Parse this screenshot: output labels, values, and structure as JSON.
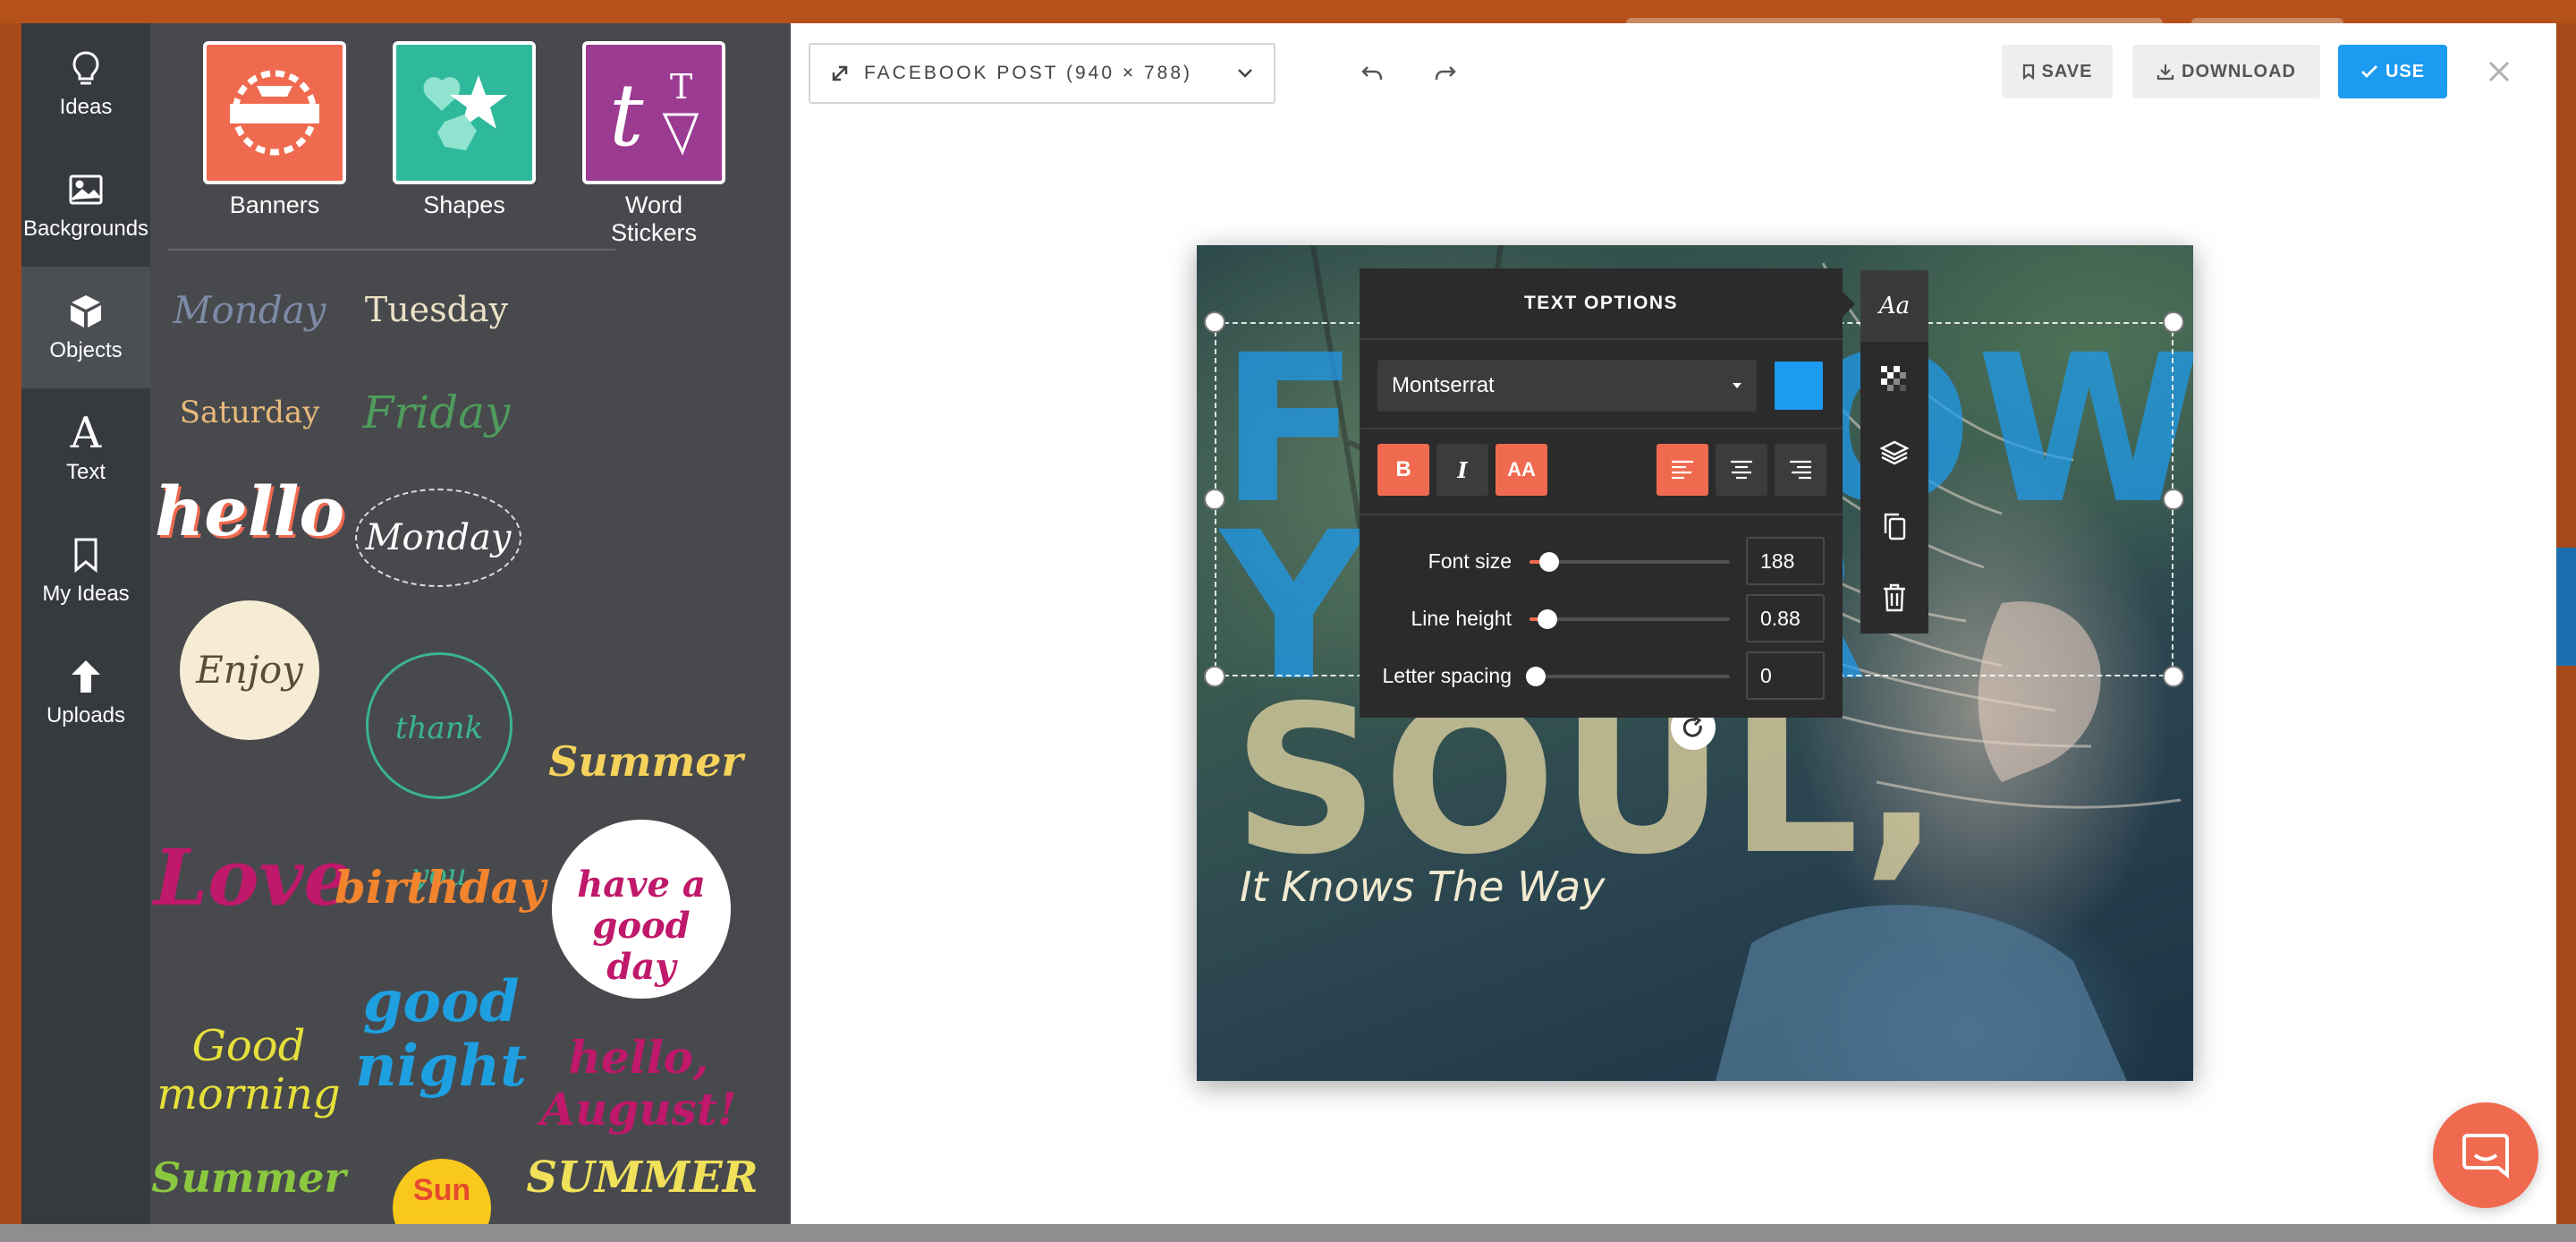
{
  "nav": {
    "items": [
      {
        "label": "Ideas",
        "icon": "lightbulb-icon"
      },
      {
        "label": "Backgrounds",
        "icon": "image-icon"
      },
      {
        "label": "Objects",
        "icon": "cube-icon",
        "active": true
      },
      {
        "label": "Text",
        "icon": "text-icon"
      },
      {
        "label": "My Ideas",
        "icon": "bookmark-icon"
      },
      {
        "label": "Uploads",
        "icon": "upload-arrow-icon"
      }
    ]
  },
  "panel": {
    "categories": [
      {
        "label": "Banners",
        "color": "#f06a4f"
      },
      {
        "label": "Shapes",
        "color": "#2fb99c"
      },
      {
        "label": "Word Stickers",
        "color": "#9b3b92"
      }
    ],
    "stickers": [
      "Monday",
      "Tuesday",
      "Saturday",
      "Friday",
      "hello",
      "Monday",
      "Enjoy",
      "thank you",
      "Summer",
      "Love",
      "birthday",
      "have a good day",
      "good night",
      "Good morning",
      "hello, August!",
      "Summer",
      "Sun",
      "SUMMER"
    ]
  },
  "toolbar": {
    "size_label": "FACEBOOK POST (940 × 788)",
    "save_label": "SAVE",
    "download_label": "DOWNLOAD",
    "use_label": "USE"
  },
  "canvas": {
    "line1": "FOLLOW",
    "line2": "YOUR",
    "line3": "SOUL,",
    "tagline": "It Knows The Way"
  },
  "text_options": {
    "title": "TEXT OPTIONS",
    "font": "Montserrat",
    "color": "#1d9bf0",
    "bold_label": "B",
    "italic_label": "I",
    "caps_label": "AA",
    "font_size_label": "Font size",
    "font_size_value": "188",
    "line_height_label": "Line height",
    "line_height_value": "0.88",
    "letter_spacing_label": "Letter spacing",
    "letter_spacing_value": "0",
    "font_size_slider_fraction": 0.1,
    "line_height_slider_fraction": 0.09,
    "letter_spacing_slider_fraction": 0.03
  },
  "tool_strip": [
    "font-style-icon",
    "transparency-icon",
    "layers-icon",
    "duplicate-icon",
    "trash-icon"
  ],
  "colors": {
    "accent": "#1d9bf0",
    "orange": "#f06a4f",
    "nav_bg": "#36393d",
    "panel_bg": "#47494d"
  }
}
